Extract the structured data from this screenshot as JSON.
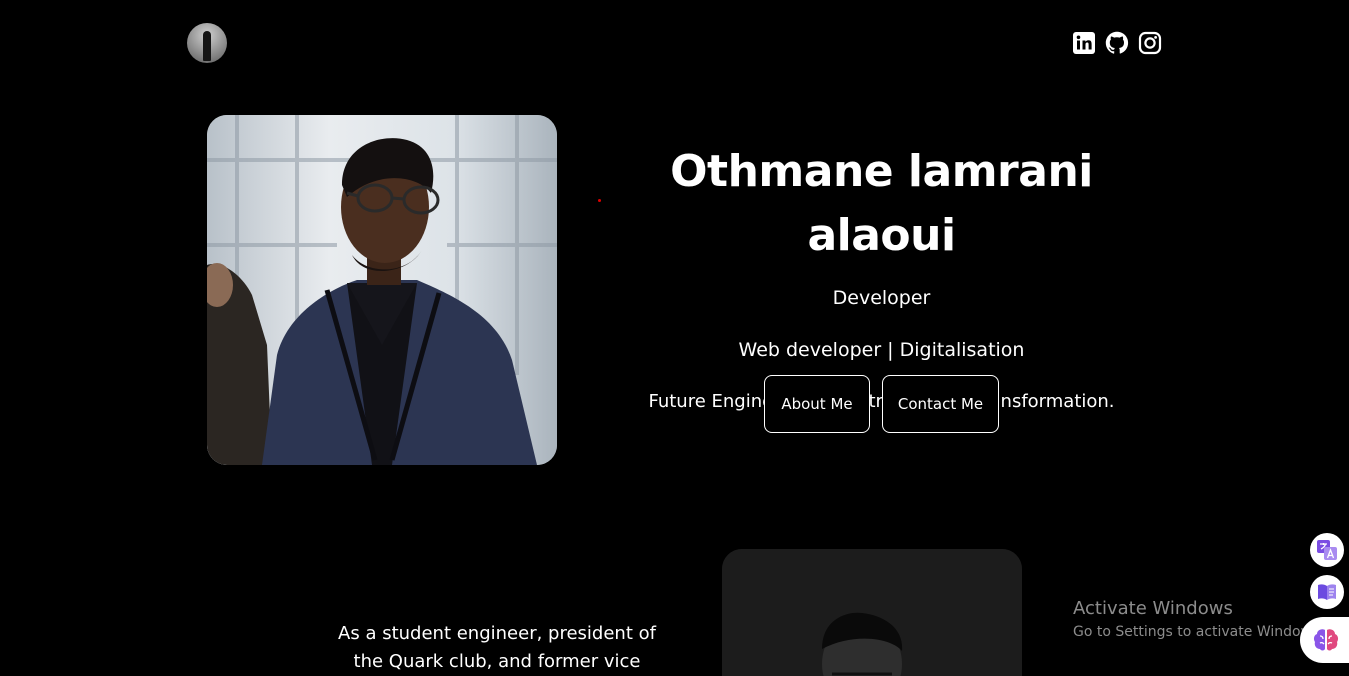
{
  "header": {
    "avatar_icon": "user-avatar",
    "socials": [
      {
        "name": "linkedin-icon"
      },
      {
        "name": "github-icon"
      },
      {
        "name": "instagram-icon"
      }
    ]
  },
  "hero": {
    "name": "Othmane lamrani alaoui",
    "role": "Developer",
    "tagline": "Web developer | Digitalisation",
    "description": "Future Engineer in Industrial Digital Transformation.",
    "about_button": "About Me",
    "contact_button": "Contact Me"
  },
  "about": {
    "text": "As a student engineer, president of the Quark club, and former vice"
  },
  "windows_watermark": {
    "title": "Activate Windows",
    "subtitle": "Go to Settings to activate Windows."
  },
  "colors": {
    "background": "#000000",
    "text": "#ffffff",
    "watermark": "#8c8c8c"
  }
}
